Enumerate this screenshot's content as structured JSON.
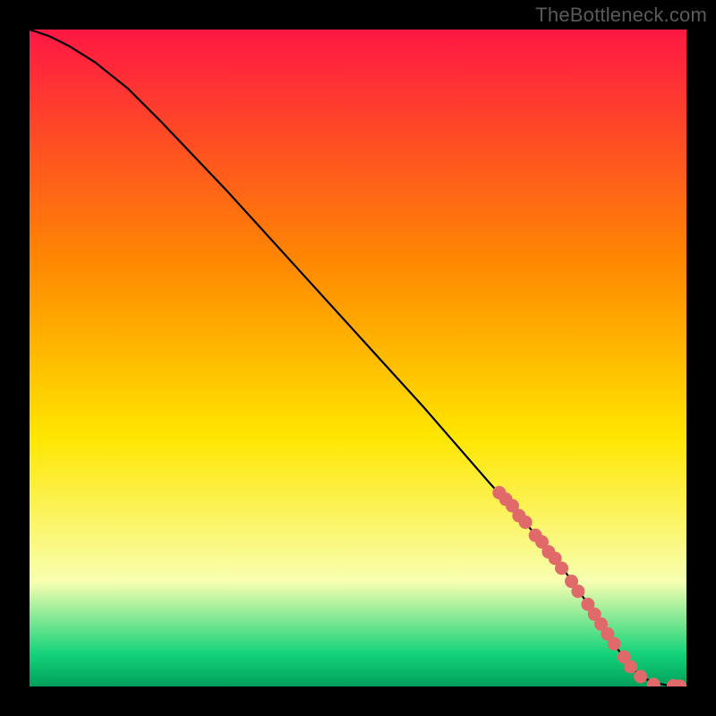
{
  "attribution": "TheBottleneck.com",
  "colors": {
    "frame": "#000000",
    "curve": "#000000",
    "marker_fill": "#e06a6a",
    "marker_stroke": "#9c3434",
    "gradient_top": "#ff1744",
    "gradient_mid1": "#ff8a00",
    "gradient_mid2": "#ffe600",
    "gradient_mid3": "#f8ffb0",
    "gradient_low": "#14d37a",
    "gradient_base": "#00a05a"
  },
  "chart_data": {
    "type": "line",
    "title": "",
    "xlabel": "",
    "ylabel": "",
    "xlim": [
      0,
      100
    ],
    "ylim": [
      0,
      100
    ],
    "series": [
      {
        "name": "bottleneck-curve",
        "x": [
          0,
          3,
          6,
          10,
          15,
          20,
          30,
          40,
          50,
          60,
          70,
          75,
          80,
          83,
          85,
          87,
          89,
          91,
          93,
          95,
          97,
          100
        ],
        "y": [
          100,
          99,
          97.5,
          95,
          91,
          86,
          75.5,
          64.5,
          53.5,
          42.5,
          31,
          25.5,
          19.5,
          15.5,
          12.5,
          9.5,
          6.5,
          3.5,
          1.5,
          0.6,
          0.2,
          0
        ]
      }
    ],
    "markers": {
      "name": "highlighted-points",
      "x": [
        71.5,
        72.5,
        73.5,
        74.5,
        75.5,
        77,
        78,
        79,
        80,
        81,
        82.5,
        83.5,
        85,
        86,
        87,
        88,
        89,
        90.5,
        91.5,
        93,
        95,
        98,
        99
      ],
      "y": [
        29.5,
        28.5,
        27.5,
        26,
        25,
        23,
        22,
        20.5,
        19.5,
        18,
        16,
        14.5,
        12.5,
        11,
        9.5,
        8,
        6.5,
        4.5,
        3,
        1.5,
        0.3,
        0.1,
        0.05
      ]
    }
  }
}
